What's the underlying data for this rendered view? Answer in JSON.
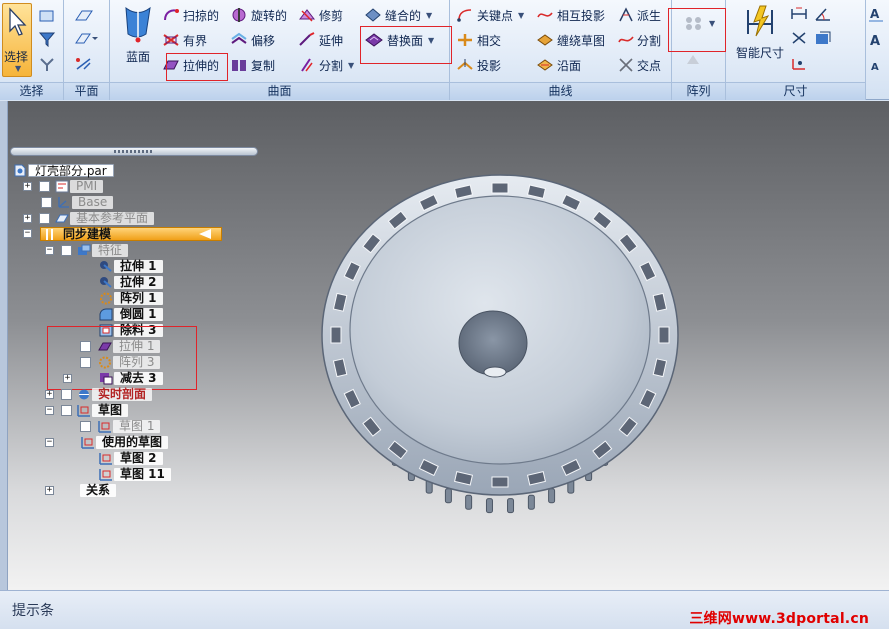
{
  "ribbon": {
    "groups": {
      "select": "选择",
      "plane": "平面",
      "surface": "曲面",
      "curve": "曲线",
      "pattern": "阵列",
      "dimension": "尺寸"
    },
    "select_button": "选择",
    "bluesurf": "蓝面",
    "surface_buttons": {
      "swept": "扫掠的",
      "revolved": "旋转的",
      "trim": "修剪",
      "stitched": "缝合的",
      "bounded": "有界",
      "offset": "偏移",
      "extend": "延伸",
      "replace_face": "替换面",
      "extruded": "拉伸的",
      "copy": "复制",
      "split": "分割"
    },
    "curve_buttons": {
      "keypoint": "关键点",
      "project_mutual": "相互投影",
      "derived": "派生",
      "intersect": "相交",
      "wrap_sketch": "缠绕草图",
      "split": "分割",
      "project": "投影",
      "along_face": "沿面",
      "intersection_point": "交点"
    },
    "smart_dimension": "智能尺寸"
  },
  "tree": {
    "root": "灯壳部分.par",
    "pmi": "PMI",
    "base": "Base",
    "ref_planes": "基本参考平面",
    "sync_modeling": "同步建模",
    "features": "特征",
    "items": [
      {
        "label": "拉伸 1"
      },
      {
        "label": "拉伸 2"
      },
      {
        "label": "阵列 1"
      },
      {
        "label": "倒圆 1"
      },
      {
        "label": "除料 3"
      },
      {
        "label": "拉伸 1"
      },
      {
        "label": "阵列 3"
      },
      {
        "label": "减去 3"
      }
    ],
    "live_section": "实时剖面",
    "sketches": "草图",
    "sketch1": "草图 1",
    "used_sketches": "使用的草图",
    "sketch2": "草图 2",
    "sketch11": "草图 11",
    "relations": "关系"
  },
  "status": {
    "prompt": "提示条",
    "watermark": "三维网www.3dportal.cn"
  },
  "colors": {
    "accent_red": "#e0242a",
    "sync_orange": "#f0a018",
    "ribbon_blue": "#d3e1f2"
  }
}
